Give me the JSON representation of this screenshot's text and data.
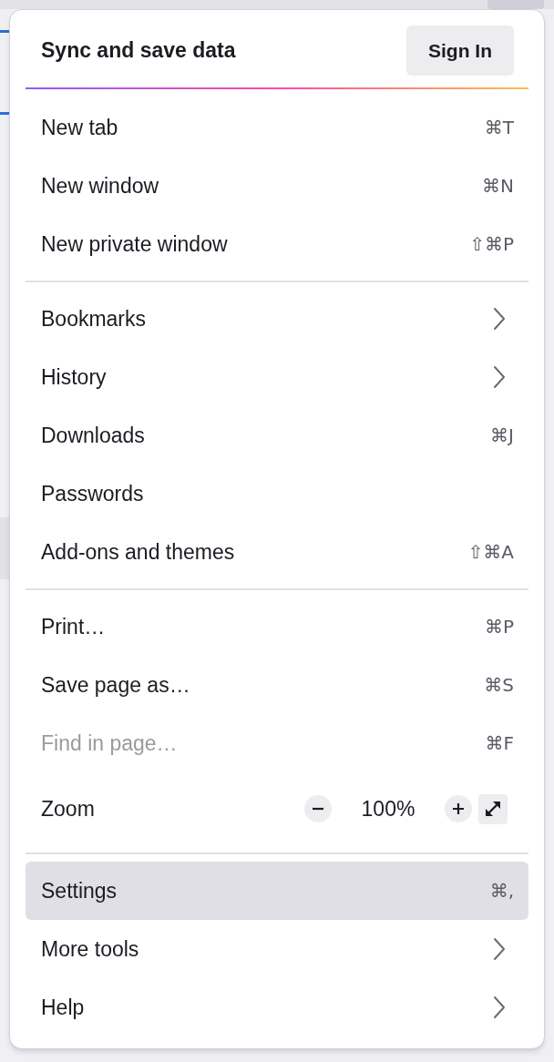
{
  "header": {
    "title": "Sync and save data",
    "button": "Sign In"
  },
  "groups": [
    {
      "items": [
        {
          "kind": "item",
          "label": "New tab",
          "shortcut": "⌘T",
          "disabled": false,
          "highlighted": false
        },
        {
          "kind": "item",
          "label": "New window",
          "shortcut": "⌘N",
          "disabled": false,
          "highlighted": false
        },
        {
          "kind": "item",
          "label": "New private window",
          "shortcut": "⇧⌘P",
          "disabled": false,
          "highlighted": false
        }
      ]
    },
    {
      "items": [
        {
          "kind": "submenu",
          "label": "Bookmarks",
          "disabled": false,
          "highlighted": false
        },
        {
          "kind": "submenu",
          "label": "History",
          "disabled": false,
          "highlighted": false
        },
        {
          "kind": "item",
          "label": "Downloads",
          "shortcut": "⌘J",
          "disabled": false,
          "highlighted": false
        },
        {
          "kind": "item",
          "label": "Passwords",
          "disabled": false,
          "highlighted": false
        },
        {
          "kind": "item",
          "label": "Add-ons and themes",
          "shortcut": "⇧⌘A",
          "disabled": false,
          "highlighted": false
        }
      ]
    },
    {
      "items": [
        {
          "kind": "item",
          "label": "Print…",
          "shortcut": "⌘P",
          "disabled": false,
          "highlighted": false
        },
        {
          "kind": "item",
          "label": "Save page as…",
          "shortcut": "⌘S",
          "disabled": false,
          "highlighted": false
        },
        {
          "kind": "item",
          "label": "Find in page…",
          "shortcut": "⌘F",
          "disabled": true,
          "highlighted": false
        },
        {
          "kind": "zoom",
          "label": "Zoom",
          "value": "100%",
          "disabled": false,
          "highlighted": false
        }
      ]
    },
    {
      "items": [
        {
          "kind": "item",
          "label": "Settings",
          "shortcut": "⌘,",
          "disabled": false,
          "highlighted": true
        },
        {
          "kind": "submenu",
          "label": "More tools",
          "disabled": false,
          "highlighted": false
        },
        {
          "kind": "submenu",
          "label": "Help",
          "disabled": false,
          "highlighted": false
        }
      ]
    }
  ]
}
